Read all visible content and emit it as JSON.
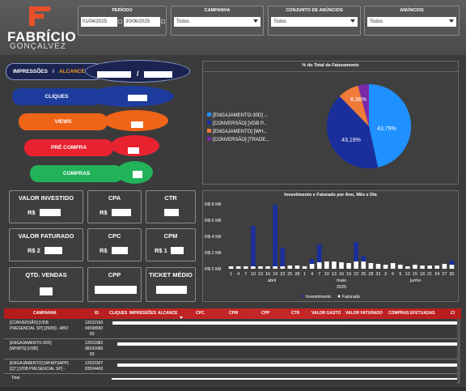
{
  "brand": {
    "title": "FABRÍCIO",
    "subtitle": "GONÇALVEZ"
  },
  "filters": {
    "period": {
      "label": "PERÍODO",
      "start": "01/04/2025",
      "end": "30/06/2025"
    },
    "campanha": {
      "label": "CAMPANHA",
      "value": "Todos"
    },
    "conjunto": {
      "label": "CONJUNTO DE ANÚNCIOS",
      "value": "Todos"
    },
    "anuncios": {
      "label": "ANÚNCIOS",
      "value": "Todos"
    }
  },
  "funnel": {
    "impressoes_label": "IMPRESSÕES",
    "separator": "/",
    "alcance_label": "ALCANCE",
    "slash": "/",
    "stages": [
      {
        "label": "CLIQUES",
        "color": "#1e3c9e"
      },
      {
        "label": "VIEWS",
        "color": "#f06418"
      },
      {
        "label": "PRÉ COMPRA",
        "color": "#e8232f"
      },
      {
        "label": "COMPRAS",
        "color": "#22b35a"
      }
    ]
  },
  "kpis": {
    "valor_investido": {
      "label": "VALOR INVESTIDO",
      "prefix": "R$"
    },
    "cpa": {
      "label": "CPA",
      "prefix": "R$"
    },
    "ctr": {
      "label": "CTR"
    },
    "valor_faturado": {
      "label": "VALOR FATURADO",
      "prefix": "R$ 2"
    },
    "cpc": {
      "label": "CPC",
      "prefix": "R$"
    },
    "cpm": {
      "label": "CPM",
      "prefix": "R$ 1"
    },
    "qtd_vendas": {
      "label": "QTD. VENDAS"
    },
    "cpp": {
      "label": "CPP"
    },
    "ticket_medio": {
      "label": "TICKET MÉDIO"
    }
  },
  "pie": {
    "title": "% do Total de Faturamento",
    "legend": [
      {
        "label": "[ENGAJAMENTO-30D] ...",
        "color": "#1e90ff"
      },
      {
        "label": "[CONVERSÃO] [VDB P...",
        "color": "#1a2f9c"
      },
      {
        "label": "[ENGAJAMENTO] [WH...",
        "color": "#f07a3a"
      },
      {
        "label": "[CONVERSÃO] [TRADE...",
        "color": "#7a2aa8"
      }
    ],
    "labels": {
      "a": "43,79%",
      "b": "43,19%",
      "c": "8,36%"
    }
  },
  "bar_chart": {
    "title": "Investimento e Faturado por Ano, Mês e Dia",
    "y_ticks": [
      "R$ 8 Mil",
      "R$ 6 Mil",
      "R$ 4 Mil",
      "R$ 2 Mil",
      "R$ 0 Mil"
    ],
    "x_ticks": [
      "1",
      "4",
      "7",
      "10",
      "13",
      "16",
      "19",
      "22",
      "25",
      "28",
      "1",
      "4",
      "7",
      "10",
      "13",
      "16",
      "19",
      "22",
      "25",
      "28",
      "31",
      "3",
      "6",
      "9",
      "12",
      "15",
      "18",
      "21",
      "24",
      "27",
      "30"
    ],
    "months": [
      "abril",
      "maio",
      "junho"
    ],
    "year": "2025",
    "legend": [
      {
        "label": "Investimento",
        "color": "#1a2f9c"
      },
      {
        "label": "Faturado",
        "color": "#ffffff"
      }
    ]
  },
  "chart_data": {
    "type": "bar",
    "title": "Investimento e Faturado por Ano, Mês e Dia",
    "ylim": [
      0,
      8
    ],
    "series": [
      {
        "name": "Investimento",
        "values": [
          0,
          0,
          0,
          5.3,
          0,
          0,
          7.9,
          2.6,
          0,
          0,
          0,
          1.2,
          3.0,
          0,
          0,
          0,
          0,
          3.3,
          0,
          0,
          0,
          0,
          0,
          0,
          0,
          0,
          0,
          0,
          0,
          0,
          0,
          0,
          0,
          0,
          0,
          0,
          0,
          0,
          0,
          0,
          0,
          0,
          0,
          0,
          0,
          0,
          0,
          0,
          0,
          0,
          0,
          0,
          0,
          0,
          0,
          0,
          0,
          0,
          0,
          0,
          0,
          0,
          0,
          0,
          0,
          1.0
        ]
      },
      {
        "name": "Faturado",
        "values": [
          0.3,
          0.3,
          0.3,
          0.3,
          0.3,
          0.3,
          0.3,
          0.3,
          0.4,
          0.4,
          0.3,
          0.6,
          0.8,
          0.9,
          0.9,
          0.8,
          0.7,
          0.9,
          0.9,
          0.7,
          0.6,
          0.5,
          0.7,
          0.5,
          0.3,
          0.5,
          0.4,
          0.4,
          0.4,
          0.6,
          0.5
        ]
      }
    ]
  },
  "bars": {
    "inv": [
      0,
      0,
      0,
      5.3,
      0,
      0,
      7.9,
      2.6,
      0,
      0,
      0,
      1.2,
      3.0,
      0,
      0,
      0,
      0,
      3.3,
      1.6,
      0,
      0,
      0,
      0,
      0,
      0,
      0,
      0,
      0,
      0,
      0,
      1.0
    ],
    "fat": [
      0.3,
      0.3,
      0.3,
      0.3,
      0.3,
      0.3,
      0.3,
      0.3,
      0.4,
      0.4,
      0.3,
      0.6,
      0.8,
      0.9,
      0.9,
      0.8,
      0.7,
      0.9,
      0.9,
      0.7,
      0.6,
      0.5,
      0.7,
      0.5,
      0.3,
      0.5,
      0.4,
      0.4,
      0.4,
      0.6,
      0.5
    ]
  },
  "table": {
    "headers": [
      "CAMPANHA",
      "ID",
      "CLIQUES",
      "IMPRESSÕES",
      "ALCANCE",
      "CPC",
      "CPM",
      "CPP",
      "CTR",
      "VALOR GASTO",
      "VALOR FATURADO",
      "COMPRAS EFETUADAS",
      "CI"
    ],
    "rows": [
      {
        "name1": "[CONVERSÃO] [VDB",
        "name2": "PRESENCIAL SP] [25/05] - ABO",
        "id1": "12022160",
        "id2": "94598580",
        "id3": "83"
      },
      {
        "name1": "[ENGAJAMENTO-30D]",
        "name2": "[WHATS] [VDB]",
        "id1": "12021982",
        "id2": "98191680",
        "id3": "83"
      },
      {
        "name1": "[ENGAJAMENTO] [WHATSAPP]",
        "name2": "[QT] [VDB PRESENCIAL SP] -",
        "id1": "12022307",
        "id2": "83504400",
        "id3": ""
      }
    ],
    "total_label": "Total"
  }
}
